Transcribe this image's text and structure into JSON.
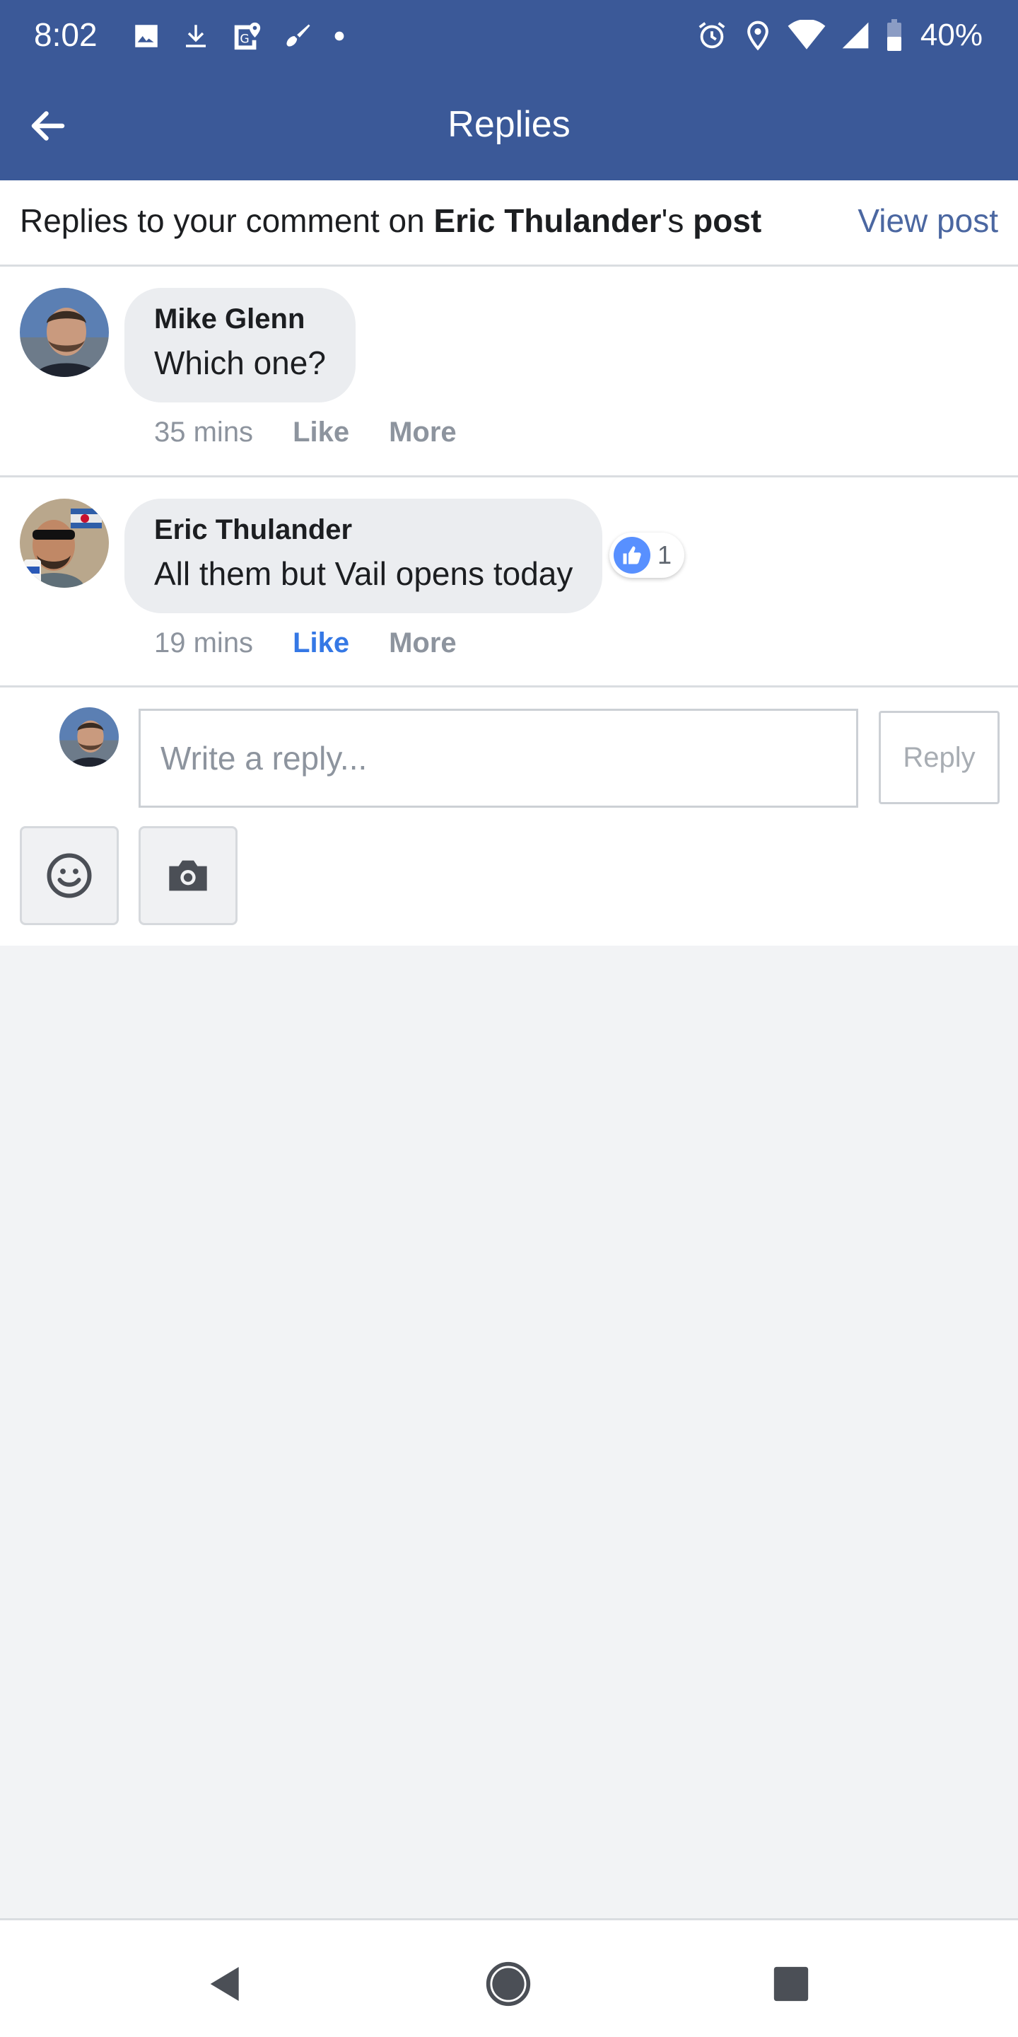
{
  "status_bar": {
    "time": "8:02",
    "battery": "40%"
  },
  "app_bar": {
    "title": "Replies"
  },
  "context": {
    "prefix": "Replies to your comment on ",
    "author": "Eric Thulander",
    "possessive": "'s ",
    "post_word": "post",
    "view_post": "View post"
  },
  "comments": [
    {
      "author": "Mike Glenn",
      "text": "Which one?",
      "time": "35 mins",
      "like": "Like",
      "more": "More"
    },
    {
      "author": "Eric Thulander",
      "text": "All them but Vail opens today",
      "time": "19 mins",
      "like": "Like",
      "more": "More",
      "reaction_count": "1"
    }
  ],
  "composer": {
    "placeholder": "Write a reply...",
    "reply_label": "Reply"
  },
  "icons": {
    "back": "arrow-left-icon",
    "emoji": "smiley-icon",
    "camera": "camera-icon",
    "like": "thumbs-up-icon"
  },
  "colors": {
    "brand": "#3b5998",
    "link": "#3578e5",
    "like_badge": "#5890ff"
  }
}
